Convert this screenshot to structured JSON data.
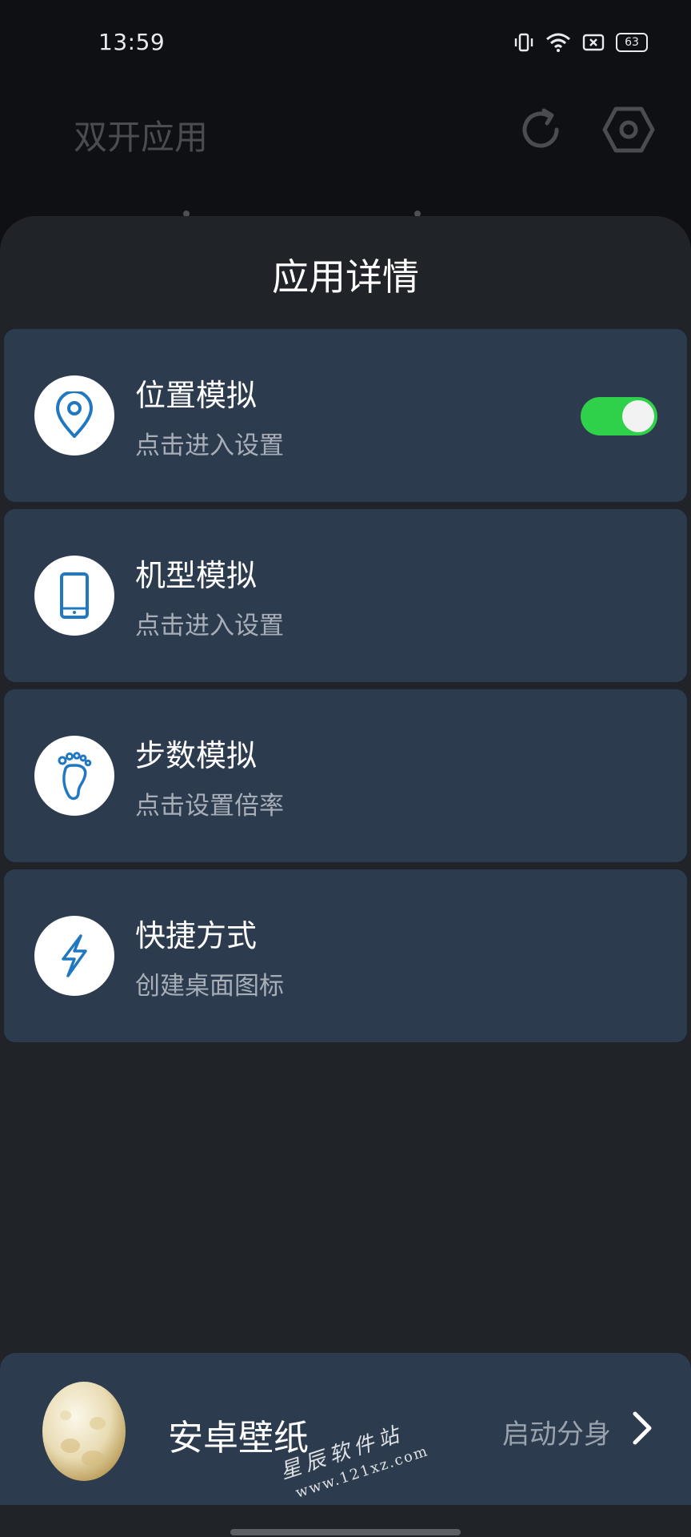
{
  "status_bar": {
    "time": "13:59",
    "battery": "63",
    "icons": [
      "vibrate-icon",
      "wifi-icon",
      "sim-error-icon",
      "battery-icon"
    ]
  },
  "header": {
    "title": "双开应用",
    "icons": [
      "refresh-icon",
      "settings-hex-icon"
    ]
  },
  "sheet": {
    "title": "应用详情",
    "items": [
      {
        "icon": "location-pin-icon",
        "title": "位置模拟",
        "subtitle": "点击进入设置",
        "toggle_on": true
      },
      {
        "icon": "phone-icon",
        "title": "机型模拟",
        "subtitle": "点击进入设置"
      },
      {
        "icon": "footprint-icon",
        "title": "步数模拟",
        "subtitle": "点击设置倍率"
      },
      {
        "icon": "lightning-icon",
        "title": "快捷方式",
        "subtitle": "创建桌面图标"
      }
    ]
  },
  "bottom_app": {
    "name": "安卓壁纸",
    "action": "启动分身",
    "icon": "egg-icon"
  },
  "watermark": {
    "line1": "星辰软件站",
    "line2": "www.121xz.com"
  },
  "colors": {
    "card": "#2d3b4e",
    "sheet": "#202328",
    "toggle_on": "#2fd14b",
    "icon_blue": "#1f78c1"
  }
}
